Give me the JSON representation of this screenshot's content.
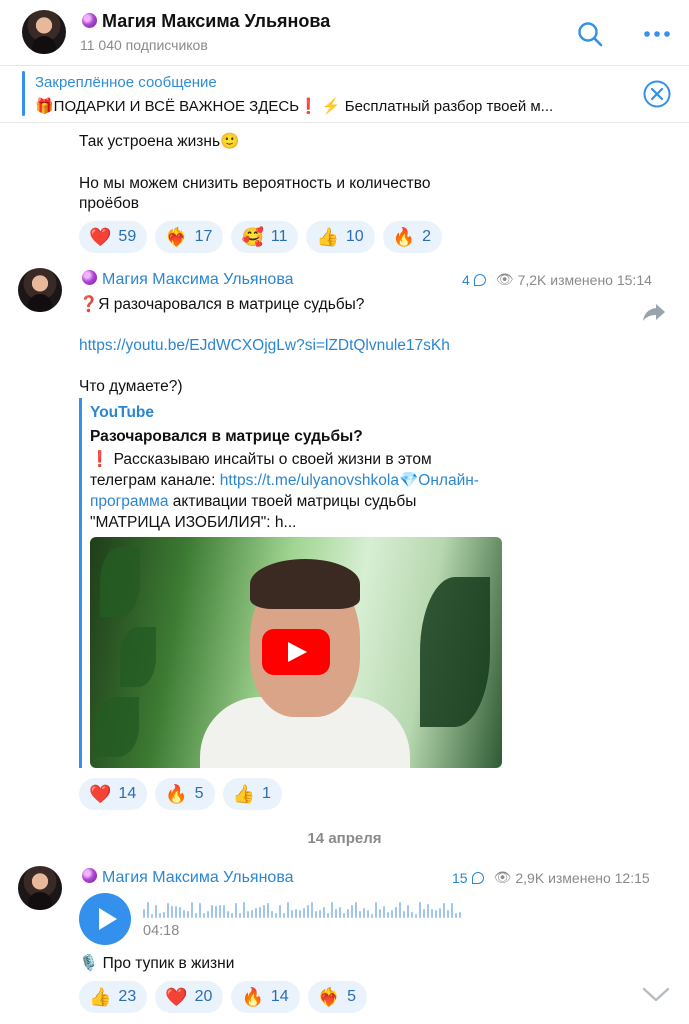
{
  "header": {
    "title": "Магия Максима Ульянова",
    "subscribers": "11 040 подписчиков",
    "icons": [
      "search-icon",
      "more-icon"
    ]
  },
  "pinned": {
    "title": "Закреплённое сообщение",
    "text": "🎁ПОДАРКИ И ВСЁ ВАЖНОЕ ЗДЕСЬ❗️ ⚡️ Бесплатный разбор твоей м..."
  },
  "post0": {
    "line1": "Так устроена жизнь🙂",
    "line2": "Но мы можем снизить вероятность и количество",
    "line3": "проёбов",
    "reactions": [
      {
        "emoji": "❤️",
        "count": "59"
      },
      {
        "emoji": "❤️‍🔥",
        "count": "17"
      },
      {
        "emoji": "🥰",
        "count": "11"
      },
      {
        "emoji": "👍",
        "count": "10"
      },
      {
        "emoji": "🔥",
        "count": "2"
      }
    ]
  },
  "post1": {
    "author": "Магия Максима Ульянова",
    "comments": "4",
    "views": "7,2K",
    "edited": "изменено 15:14",
    "title": "❓Я разочаровался в матрице судьбы?",
    "url": "https://youtu.be/EJdWCXOjgLw?si=lZDtQlvnule17sKh",
    "question": "Что думаете?)",
    "preview": {
      "source": "YouTube",
      "title": "Разочаровался в матрице судьбы?",
      "desc_1": "❗ Рассказываю инсайты о своей жизни в этом телеграм канале: ",
      "desc_link": "https://t.me/ulyanovshkola",
      "desc_2": "💎",
      "desc_link2": "Онлайн-программа",
      "desc_3": " активации твоей матрицы судьбы \"МАТРИЦА ИЗОБИЛИЯ\": h..."
    },
    "reactions": [
      {
        "emoji": "❤️",
        "count": "14"
      },
      {
        "emoji": "🔥",
        "count": "5"
      },
      {
        "emoji": "👍",
        "count": "1"
      }
    ]
  },
  "date_separator": "14 апреля",
  "post2": {
    "author": "Магия Максима Ульянова",
    "comments": "15",
    "views": "2,9K",
    "edited": "изменено 12:15",
    "duration": "04:18",
    "caption": "🎙️ Про тупик в жизни",
    "reactions": [
      {
        "emoji": "👍",
        "count": "23"
      },
      {
        "emoji": "❤️",
        "count": "20"
      },
      {
        "emoji": "🔥",
        "count": "14"
      },
      {
        "emoji": "❤️‍🔥",
        "count": "5"
      }
    ]
  },
  "colors": {
    "accent": "#3390ec",
    "link": "#2b86d1",
    "reaction_bg": "#eaf2fb"
  }
}
